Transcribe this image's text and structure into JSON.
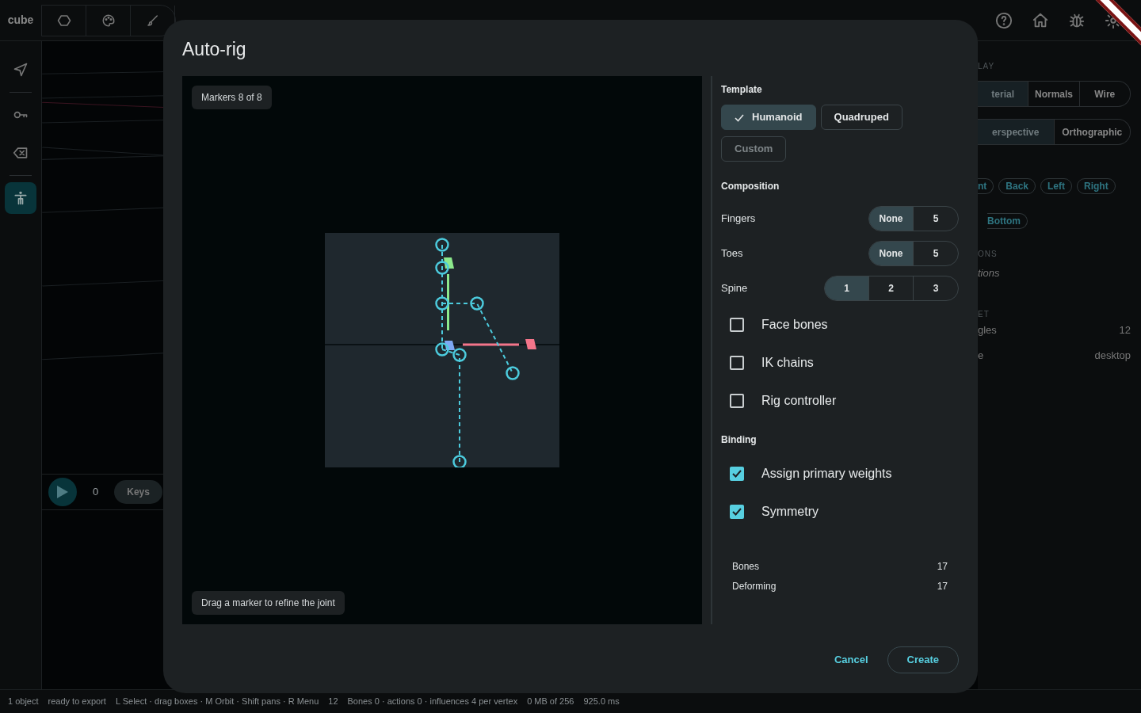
{
  "app_title": "cube",
  "rail_tools": [
    {
      "selected": false
    },
    {
      "selected": false
    },
    {
      "selected": false
    },
    {
      "selected": true
    }
  ],
  "timeline": {
    "frame": "0",
    "keys_button": "Keys"
  },
  "right_panel": {
    "display_heading": "LAY",
    "shading": [
      {
        "label": "terial",
        "selected": true
      },
      {
        "label": "Normals",
        "selected": false
      },
      {
        "label": "Wire",
        "selected": false
      }
    ],
    "projection": [
      {
        "label": "erspective",
        "selected": true
      },
      {
        "label": "Orthographic",
        "selected": false
      }
    ],
    "views_row_1": [
      "nt",
      "Back",
      "Left",
      "Right"
    ],
    "views_row_2": [
      "Bottom"
    ],
    "section_heading": "ONS",
    "note": "tions",
    "budget_heading": "ET",
    "stats": [
      {
        "label": "gles",
        "value": "12"
      },
      {
        "label": "e",
        "value": "desktop"
      }
    ]
  },
  "dialog": {
    "title": "Auto-rig",
    "marker_chip": "Markers 8 of 8",
    "hint_chip": "Drag a marker to refine the joint",
    "template_heading": "Template",
    "templates": [
      {
        "label": "Humanoid",
        "selected": true,
        "disabled": false
      },
      {
        "label": "Quadruped",
        "selected": false,
        "disabled": false
      },
      {
        "label": "Custom",
        "selected": false,
        "disabled": true
      }
    ],
    "composition_heading": "Composition",
    "composition": [
      {
        "label": "Fingers",
        "options": [
          {
            "label": "None",
            "selected": true
          },
          {
            "label": "5",
            "selected": false
          }
        ]
      },
      {
        "label": "Toes",
        "options": [
          {
            "label": "None",
            "selected": true
          },
          {
            "label": "5",
            "selected": false
          }
        ]
      },
      {
        "label": "Spine",
        "options": [
          {
            "label": "1",
            "selected": true
          },
          {
            "label": "2",
            "selected": false
          },
          {
            "label": "3",
            "selected": false
          }
        ]
      }
    ],
    "options": [
      {
        "label": "Face bones",
        "checked": false
      },
      {
        "label": "IK chains",
        "checked": false
      },
      {
        "label": "Rig controller",
        "checked": false
      }
    ],
    "binding_heading": "Binding",
    "binding": [
      {
        "label": "Assign primary weights",
        "checked": true
      },
      {
        "label": "Symmetry",
        "checked": true
      }
    ],
    "stats": [
      {
        "label": "Bones",
        "value": "17"
      },
      {
        "label": "Deforming",
        "value": "17"
      }
    ],
    "cancel_button": "Cancel",
    "create_button": "Create"
  },
  "status_bar": [
    "1 object",
    "ready to export",
    "L Select · drag boxes · M Orbit · Shift pans · R Menu",
    "12",
    "Bones 0 · actions 0 · influences 4 per vertex",
    "0 MB of 256",
    "925.0 ms"
  ]
}
